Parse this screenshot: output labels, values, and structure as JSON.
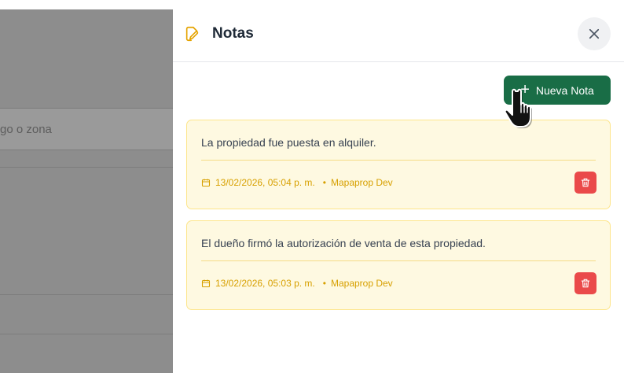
{
  "backdrop": {
    "search_fragment": "go o zona"
  },
  "panel": {
    "title": "Notas",
    "icon": "edit-note-icon",
    "close_icon": "close-icon",
    "new_note_label": "Nueva Nota"
  },
  "notes": [
    {
      "text": "La propiedad fue puesta en alquiler.",
      "date": "13/02/2026, 05:04 p. m.",
      "author": "Mapaprop Dev"
    },
    {
      "text": "El dueño firmó la autorización de venta de esta propiedad.",
      "date": "13/02/2026, 05:03 p. m.",
      "author": "Mapaprop Dev"
    }
  ],
  "colors": {
    "accent_green": "#196d46",
    "note_bg": "#fef9e1",
    "note_border": "#fde58a",
    "meta_text": "#d7a000",
    "delete_red": "#ea4a4a"
  }
}
